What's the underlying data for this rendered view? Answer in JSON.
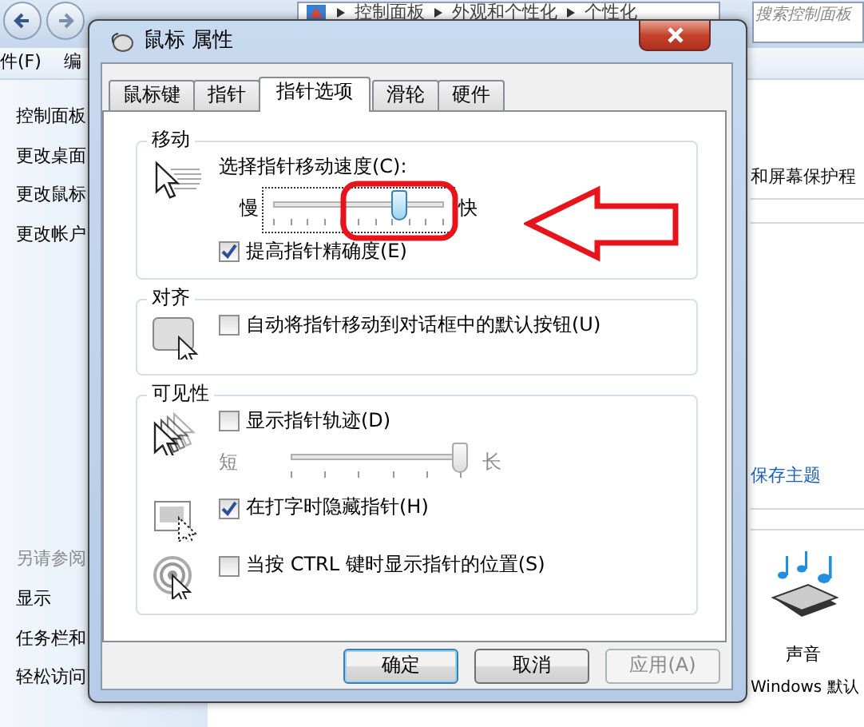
{
  "explorer": {
    "breadcrumb": [
      "控制面板",
      "外观和个性化",
      "个性化"
    ],
    "search": {
      "placeholder": "搜索控制面板"
    },
    "menu": [
      "件(F)",
      "编"
    ],
    "sidebar": {
      "links": [
        "控制面板",
        "更改桌面",
        "更改鼠标",
        "更改帐户"
      ],
      "see_also_heading": "另请参阅",
      "see_also": [
        "显示",
        "任务栏和",
        "轻松访问"
      ]
    },
    "content": {
      "screensaver_link": "和屏幕保护程",
      "save_theme": "保存主题",
      "sound": {
        "label": "声音",
        "value": "Windows 默认"
      }
    }
  },
  "dialog": {
    "title": "鼠标 属性",
    "tabs": [
      {
        "label": "鼠标键",
        "selected": false
      },
      {
        "label": "指针",
        "selected": false
      },
      {
        "label": "指针选项",
        "selected": true
      },
      {
        "label": "滑轮",
        "selected": false
      },
      {
        "label": "硬件",
        "selected": false
      }
    ],
    "groups": [
      {
        "title": "移动",
        "sections": [
          {
            "rows": [
              {
                "kind": "label",
                "text": "选择指针移动速度(C):"
              },
              {
                "kind": "slider",
                "min_label": "慢",
                "max_label": "快",
                "level": 0.74,
                "disabled": false,
                "focused": true
              },
              {
                "kind": "checkbox",
                "label": "提高指针精确度(E)",
                "checked": true
              }
            ]
          }
        ]
      },
      {
        "title": "对齐",
        "sections": [
          {
            "rows": [
              {
                "kind": "checkbox",
                "label": "自动将指针移动到对话框中的默认按钮(U)",
                "checked": false
              }
            ]
          }
        ]
      },
      {
        "title": "可见性",
        "sections": [
          {
            "rows": [
              {
                "kind": "checkbox",
                "label": "显示指针轨迹(D)",
                "checked": false
              },
              {
                "kind": "slider",
                "min_label": "短",
                "max_label": "长",
                "level": 1,
                "disabled": true,
                "focused": false
              }
            ]
          },
          {
            "rows": [
              {
                "kind": "checkbox",
                "label": "在打字时隐藏指针(H)",
                "checked": true
              }
            ]
          },
          {
            "rows": [
              {
                "kind": "checkbox",
                "label": "当按 CTRL 键时显示指针的位置(S)",
                "checked": false
              }
            ]
          }
        ]
      }
    ],
    "buttons": [
      {
        "label": "确定",
        "default": true,
        "disabled": false
      },
      {
        "label": "取消",
        "default": false,
        "disabled": false
      },
      {
        "label": "应用(A)",
        "default": false,
        "disabled": true
      }
    ]
  },
  "annotations": [
    {
      "kind": "highlight"
    },
    {
      "kind": "arrow"
    }
  ]
}
